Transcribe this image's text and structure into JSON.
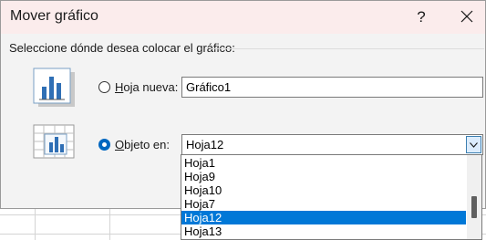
{
  "dialog": {
    "title": "Mover gráfico",
    "help_label": "?",
    "prompt": "Seleccione dónde desea colocar el gráfico:"
  },
  "options": {
    "new_sheet": {
      "key": "H",
      "rest": "oja nueva:",
      "value": "Gráfico1",
      "selected": false
    },
    "object_in": {
      "key": "O",
      "rest": "bjeto en:",
      "value": "Hoja12",
      "selected": true
    }
  },
  "dropdown": {
    "items": [
      "Hoja1",
      "Hoja9",
      "Hoja10",
      "Hoja7",
      "Hoja12",
      "Hoja13"
    ],
    "selected_index": 4
  },
  "colors": {
    "accent": "#0078d7",
    "titlebar": "#fbecec"
  },
  "icons": {
    "new_sheet": "chart-sheet-icon",
    "object": "embedded-chart-icon",
    "close": "close-icon",
    "dropdown": "chevron-down-icon"
  }
}
